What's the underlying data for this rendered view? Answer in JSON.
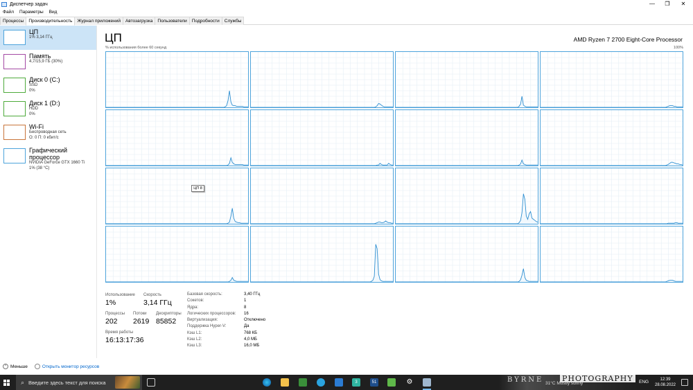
{
  "window": {
    "title": "Диспетчер задач",
    "minimize": "—",
    "maximize": "❐",
    "close": "✕"
  },
  "menu": [
    "Файл",
    "Параметры",
    "Вид"
  ],
  "tabs": [
    "Процессы",
    "Производительность",
    "Журнал приложений",
    "Автозагрузка",
    "Пользователи",
    "Подробности",
    "Службы"
  ],
  "active_tab": 1,
  "sidebar": [
    {
      "name": "ЦП",
      "sub1": "1% 3,14 ГГц",
      "sub2": "",
      "sub3": "",
      "color": "#4da3db"
    },
    {
      "name": "Память",
      "sub1": "4,7/15,9 ГБ (30%)",
      "sub2": "",
      "sub3": "",
      "color": "#a349a4"
    },
    {
      "name": "Диск 0 (C:)",
      "sub1": "SSD",
      "sub2": "0%",
      "sub3": "",
      "color": "#4daa3a"
    },
    {
      "name": "Диск 1 (D:)",
      "sub1": "HDD",
      "sub2": "0%",
      "sub3": "",
      "color": "#4daa3a"
    },
    {
      "name": "Wi-Fi",
      "sub1": "Беспроводная сеть",
      "sub2": "О: 0 П: 0 кбит/с",
      "sub3": "",
      "color": "#c8743a"
    },
    {
      "name": "Графический процессор",
      "sub1": "NVIDIA GeForce GTX 1660 Ti",
      "sub2": "1% (38 °C)",
      "sub3": "",
      "color": "#4da3db"
    }
  ],
  "main": {
    "title": "ЦП",
    "cpu_model": "AMD Ryzen 7 2700 Eight-Core Processor",
    "util_label": "% использования более 60 секунд",
    "pct_max": "100%",
    "tooltip": "ЦП 8"
  },
  "core_graphs": [
    [
      0,
      0,
      0,
      0,
      0,
      0,
      0,
      0,
      0,
      0,
      0,
      0,
      0,
      0,
      0,
      0,
      0,
      0,
      0,
      0,
      0,
      0,
      0,
      0,
      0,
      0,
      0,
      0,
      0,
      0,
      0,
      0,
      0,
      0,
      0,
      0,
      0,
      0,
      0,
      0,
      0,
      0,
      0,
      0,
      0,
      0,
      0,
      0,
      0,
      0,
      0,
      0,
      0,
      0,
      0,
      0,
      0,
      0,
      0,
      0,
      0,
      0,
      0,
      0,
      0,
      0,
      0,
      0,
      0,
      0,
      0,
      0,
      0,
      0,
      0,
      0,
      0,
      0,
      0,
      0,
      0,
      0,
      0,
      1,
      3,
      12,
      30,
      10,
      4,
      3,
      3,
      2,
      2,
      2,
      2,
      2,
      1,
      1,
      1,
      1
    ],
    [
      0,
      0,
      0,
      0,
      0,
      0,
      0,
      0,
      0,
      0,
      0,
      0,
      0,
      0,
      0,
      0,
      0,
      0,
      0,
      0,
      0,
      0,
      0,
      0,
      0,
      0,
      0,
      0,
      0,
      0,
      0,
      0,
      0,
      0,
      0,
      0,
      0,
      0,
      0,
      0,
      0,
      0,
      0,
      0,
      0,
      0,
      0,
      0,
      0,
      0,
      0,
      0,
      0,
      0,
      0,
      0,
      0,
      0,
      0,
      0,
      0,
      0,
      0,
      0,
      0,
      0,
      0,
      0,
      0,
      0,
      0,
      0,
      0,
      0,
      0,
      0,
      0,
      0,
      0,
      0,
      0,
      0,
      0,
      0,
      0,
      0,
      0,
      1,
      3,
      7,
      6,
      4,
      2,
      1,
      1,
      1,
      1,
      1,
      1,
      1
    ],
    [
      0,
      0,
      0,
      0,
      0,
      0,
      0,
      0,
      0,
      0,
      0,
      0,
      0,
      0,
      0,
      0,
      0,
      0,
      0,
      0,
      0,
      0,
      0,
      0,
      0,
      0,
      0,
      0,
      0,
      0,
      0,
      0,
      0,
      0,
      0,
      0,
      0,
      0,
      0,
      0,
      0,
      0,
      0,
      0,
      0,
      0,
      0,
      0,
      0,
      0,
      0,
      0,
      0,
      0,
      0,
      0,
      0,
      0,
      0,
      0,
      0,
      0,
      0,
      0,
      0,
      0,
      0,
      0,
      0,
      0,
      0,
      0,
      0,
      0,
      0,
      0,
      0,
      0,
      0,
      0,
      0,
      0,
      0,
      0,
      0,
      0,
      2,
      6,
      20,
      4,
      2,
      1,
      1,
      1,
      1,
      1,
      1,
      1,
      1,
      1
    ],
    [
      0,
      0,
      0,
      0,
      0,
      0,
      0,
      0,
      0,
      0,
      0,
      0,
      0,
      0,
      0,
      0,
      0,
      0,
      0,
      0,
      0,
      0,
      0,
      0,
      0,
      0,
      0,
      0,
      0,
      0,
      0,
      0,
      0,
      0,
      0,
      0,
      0,
      0,
      0,
      0,
      0,
      0,
      0,
      0,
      0,
      0,
      0,
      0,
      0,
      0,
      0,
      0,
      0,
      0,
      0,
      0,
      0,
      0,
      0,
      0,
      0,
      0,
      0,
      0,
      0,
      0,
      0,
      0,
      0,
      0,
      0,
      0,
      0,
      0,
      0,
      0,
      0,
      0,
      0,
      0,
      0,
      0,
      0,
      0,
      0,
      0,
      0,
      0,
      1,
      2,
      3,
      3,
      3,
      2,
      2,
      1,
      1,
      1,
      1,
      1
    ],
    [
      0,
      0,
      0,
      0,
      0,
      0,
      0,
      0,
      0,
      0,
      0,
      0,
      0,
      0,
      0,
      0,
      0,
      0,
      0,
      0,
      0,
      0,
      0,
      0,
      0,
      0,
      0,
      0,
      0,
      0,
      0,
      0,
      0,
      0,
      0,
      0,
      0,
      0,
      0,
      0,
      0,
      0,
      0,
      0,
      0,
      0,
      0,
      0,
      0,
      0,
      0,
      0,
      0,
      0,
      0,
      0,
      0,
      0,
      0,
      0,
      0,
      0,
      0,
      0,
      0,
      0,
      0,
      0,
      0,
      0,
      0,
      0,
      0,
      0,
      0,
      0,
      0,
      0,
      0,
      0,
      0,
      0,
      0,
      0,
      0,
      1,
      4,
      14,
      6,
      3,
      2,
      2,
      2,
      2,
      2,
      2,
      1,
      1,
      1,
      1
    ],
    [
      0,
      0,
      0,
      0,
      0,
      0,
      0,
      0,
      0,
      0,
      0,
      0,
      0,
      0,
      0,
      0,
      0,
      0,
      0,
      0,
      0,
      0,
      0,
      0,
      0,
      0,
      0,
      0,
      0,
      0,
      0,
      0,
      0,
      0,
      0,
      0,
      0,
      0,
      0,
      0,
      0,
      0,
      0,
      0,
      0,
      0,
      0,
      0,
      0,
      0,
      0,
      0,
      0,
      0,
      0,
      0,
      0,
      0,
      0,
      0,
      0,
      0,
      0,
      0,
      0,
      0,
      0,
      0,
      0,
      0,
      0,
      0,
      0,
      0,
      0,
      0,
      0,
      0,
      0,
      0,
      0,
      0,
      0,
      0,
      0,
      0,
      0,
      0,
      1,
      1,
      4,
      2,
      1,
      1,
      1,
      1,
      4,
      2,
      1,
      1
    ],
    [
      0,
      0,
      0,
      0,
      0,
      0,
      0,
      0,
      0,
      0,
      0,
      0,
      0,
      0,
      0,
      0,
      0,
      0,
      0,
      0,
      0,
      0,
      0,
      0,
      0,
      0,
      0,
      0,
      0,
      0,
      0,
      0,
      0,
      0,
      0,
      0,
      0,
      0,
      0,
      0,
      0,
      0,
      0,
      0,
      0,
      0,
      0,
      0,
      0,
      0,
      0,
      0,
      0,
      0,
      0,
      0,
      0,
      0,
      0,
      0,
      0,
      0,
      0,
      0,
      0,
      0,
      0,
      0,
      0,
      0,
      0,
      0,
      0,
      0,
      0,
      0,
      0,
      0,
      0,
      0,
      0,
      0,
      0,
      0,
      0,
      0,
      1,
      3,
      10,
      3,
      2,
      1,
      1,
      1,
      1,
      1,
      1,
      1,
      1,
      1
    ],
    [
      0,
      0,
      0,
      0,
      0,
      0,
      0,
      0,
      0,
      0,
      0,
      0,
      0,
      0,
      0,
      0,
      0,
      0,
      0,
      0,
      0,
      0,
      0,
      0,
      0,
      0,
      0,
      0,
      0,
      0,
      0,
      0,
      0,
      0,
      0,
      0,
      0,
      0,
      0,
      0,
      0,
      0,
      0,
      0,
      0,
      0,
      0,
      0,
      0,
      0,
      0,
      0,
      0,
      0,
      0,
      0,
      0,
      0,
      0,
      0,
      0,
      0,
      0,
      0,
      0,
      0,
      0,
      0,
      0,
      0,
      0,
      0,
      0,
      0,
      0,
      0,
      0,
      0,
      0,
      0,
      0,
      0,
      0,
      0,
      0,
      0,
      0,
      0,
      1,
      2,
      4,
      6,
      6,
      5,
      4,
      3,
      3,
      2,
      2,
      1
    ],
    [
      0,
      0,
      0,
      0,
      0,
      0,
      0,
      0,
      0,
      0,
      0,
      0,
      0,
      0,
      0,
      0,
      0,
      0,
      0,
      0,
      0,
      0,
      0,
      0,
      0,
      0,
      0,
      0,
      0,
      0,
      0,
      0,
      0,
      0,
      0,
      0,
      0,
      0,
      0,
      0,
      0,
      0,
      0,
      0,
      0,
      0,
      0,
      0,
      0,
      0,
      0,
      0,
      0,
      0,
      0,
      0,
      0,
      0,
      0,
      0,
      0,
      0,
      0,
      0,
      0,
      0,
      0,
      0,
      0,
      0,
      0,
      0,
      0,
      0,
      0,
      0,
      0,
      0,
      0,
      0,
      0,
      0,
      0,
      0,
      0,
      1,
      3,
      14,
      28,
      10,
      4,
      3,
      2,
      2,
      1,
      1,
      1,
      1,
      1,
      1
    ],
    [
      0,
      0,
      0,
      0,
      0,
      0,
      0,
      0,
      0,
      0,
      0,
      0,
      0,
      0,
      0,
      0,
      0,
      0,
      0,
      0,
      0,
      0,
      0,
      0,
      0,
      0,
      0,
      0,
      0,
      0,
      0,
      0,
      0,
      0,
      0,
      0,
      0,
      0,
      0,
      0,
      0,
      0,
      0,
      0,
      0,
      0,
      0,
      0,
      0,
      0,
      0,
      0,
      0,
      0,
      0,
      0,
      0,
      0,
      0,
      0,
      0,
      0,
      0,
      0,
      0,
      0,
      0,
      0,
      0,
      0,
      0,
      0,
      0,
      0,
      0,
      0,
      0,
      0,
      0,
      0,
      0,
      0,
      0,
      0,
      0,
      0,
      0,
      1,
      2,
      3,
      3,
      2,
      2,
      3,
      5,
      3,
      2,
      2,
      1,
      1
    ],
    [
      0,
      0,
      0,
      0,
      0,
      0,
      0,
      0,
      0,
      0,
      0,
      0,
      0,
      0,
      0,
      0,
      0,
      0,
      0,
      0,
      0,
      0,
      0,
      0,
      0,
      0,
      0,
      0,
      0,
      0,
      0,
      0,
      0,
      0,
      0,
      0,
      0,
      0,
      0,
      0,
      0,
      0,
      0,
      0,
      0,
      0,
      0,
      0,
      0,
      0,
      0,
      0,
      0,
      0,
      0,
      0,
      0,
      0,
      0,
      0,
      0,
      0,
      0,
      0,
      0,
      0,
      0,
      0,
      0,
      0,
      0,
      0,
      0,
      0,
      0,
      0,
      0,
      0,
      0,
      0,
      0,
      0,
      0,
      0,
      0,
      0,
      2,
      6,
      20,
      54,
      44,
      14,
      8,
      18,
      22,
      10,
      8,
      6,
      4,
      3
    ],
    [
      0,
      0,
      0,
      0,
      0,
      0,
      0,
      0,
      0,
      0,
      0,
      0,
      0,
      0,
      0,
      0,
      0,
      0,
      0,
      0,
      0,
      0,
      0,
      0,
      0,
      0,
      0,
      0,
      0,
      0,
      0,
      0,
      0,
      0,
      0,
      0,
      0,
      0,
      0,
      0,
      0,
      0,
      0,
      0,
      0,
      0,
      0,
      0,
      0,
      0,
      0,
      0,
      0,
      0,
      0,
      0,
      0,
      0,
      0,
      0,
      0,
      0,
      0,
      0,
      0,
      0,
      0,
      0,
      0,
      0,
      0,
      0,
      0,
      0,
      0,
      0,
      0,
      0,
      0,
      0,
      0,
      0,
      0,
      0,
      0,
      0,
      0,
      0,
      0,
      1,
      1,
      1,
      1,
      1,
      2,
      2,
      1,
      1,
      1,
      1
    ],
    [
      0,
      0,
      0,
      0,
      0,
      0,
      0,
      0,
      0,
      0,
      0,
      0,
      0,
      0,
      0,
      0,
      0,
      0,
      0,
      0,
      0,
      0,
      0,
      0,
      0,
      0,
      0,
      0,
      0,
      0,
      0,
      0,
      0,
      0,
      0,
      0,
      0,
      0,
      0,
      0,
      0,
      0,
      0,
      0,
      0,
      0,
      0,
      0,
      0,
      0,
      0,
      0,
      0,
      0,
      0,
      0,
      0,
      0,
      0,
      0,
      0,
      0,
      0,
      0,
      0,
      0,
      0,
      0,
      0,
      0,
      0,
      0,
      0,
      0,
      0,
      0,
      0,
      0,
      0,
      0,
      0,
      0,
      0,
      0,
      0,
      0,
      1,
      3,
      8,
      3,
      2,
      1,
      1,
      1,
      1,
      1,
      1,
      1,
      1,
      1
    ],
    [
      0,
      0,
      0,
      0,
      0,
      0,
      0,
      0,
      0,
      0,
      0,
      0,
      0,
      0,
      0,
      0,
      0,
      0,
      0,
      0,
      0,
      0,
      0,
      0,
      0,
      0,
      0,
      0,
      0,
      0,
      0,
      0,
      0,
      0,
      0,
      0,
      0,
      0,
      0,
      0,
      0,
      0,
      0,
      0,
      0,
      0,
      0,
      0,
      0,
      0,
      0,
      0,
      0,
      0,
      0,
      0,
      0,
      0,
      0,
      0,
      0,
      0,
      0,
      0,
      0,
      0,
      0,
      0,
      0,
      0,
      0,
      0,
      0,
      0,
      0,
      0,
      0,
      0,
      0,
      0,
      0,
      0,
      0,
      0,
      1,
      3,
      10,
      68,
      60,
      14,
      4,
      2,
      1,
      1,
      1,
      1,
      1,
      1,
      1,
      1
    ],
    [
      0,
      0,
      0,
      0,
      0,
      0,
      0,
      0,
      0,
      0,
      0,
      0,
      0,
      0,
      0,
      0,
      0,
      0,
      0,
      0,
      0,
      0,
      0,
      0,
      0,
      0,
      0,
      0,
      0,
      0,
      0,
      0,
      0,
      0,
      0,
      0,
      0,
      0,
      0,
      0,
      0,
      0,
      0,
      0,
      0,
      0,
      0,
      0,
      0,
      0,
      0,
      0,
      0,
      0,
      0,
      0,
      0,
      0,
      0,
      0,
      0,
      0,
      0,
      0,
      0,
      0,
      0,
      0,
      0,
      0,
      0,
      0,
      0,
      0,
      0,
      0,
      0,
      0,
      0,
      0,
      0,
      0,
      0,
      0,
      0,
      0,
      1,
      4,
      12,
      24,
      8,
      3,
      2,
      1,
      1,
      1,
      1,
      1,
      1,
      1
    ],
    [
      0,
      0,
      0,
      0,
      0,
      0,
      0,
      0,
      0,
      0,
      0,
      0,
      0,
      0,
      0,
      0,
      0,
      0,
      0,
      0,
      0,
      0,
      0,
      0,
      0,
      0,
      0,
      0,
      0,
      0,
      0,
      0,
      0,
      0,
      0,
      0,
      0,
      0,
      0,
      0,
      0,
      0,
      0,
      0,
      0,
      0,
      0,
      0,
      0,
      0,
      0,
      0,
      0,
      0,
      0,
      0,
      0,
      0,
      0,
      0,
      0,
      0,
      0,
      0,
      0,
      0,
      0,
      0,
      0,
      0,
      0,
      0,
      0,
      0,
      0,
      0,
      0,
      0,
      0,
      0,
      0,
      0,
      0,
      0,
      0,
      0,
      0,
      0,
      1,
      2,
      3,
      3,
      3,
      2,
      1,
      1,
      1,
      1,
      1,
      1
    ]
  ],
  "stats": {
    "usage_label": "Использование",
    "usage": "1%",
    "speed_label": "Скорость",
    "speed": "3,14 ГГц",
    "processes_label": "Процессы",
    "processes": "202",
    "threads_label": "Потоки",
    "threads": "2619",
    "handles_label": "Дескрипторы",
    "handles": "85852",
    "uptime_label": "Время работы",
    "uptime": "16:13:17:36"
  },
  "details": [
    {
      "k": "Базовая скорость:",
      "v": "3,40 ГГц"
    },
    {
      "k": "Сокетов:",
      "v": "1"
    },
    {
      "k": "Ядра:",
      "v": "8"
    },
    {
      "k": "Логических процессоров:",
      "v": "16"
    },
    {
      "k": "Виртуализация:",
      "v": "Отключено"
    },
    {
      "k": "Поддержка Hyper-V:",
      "v": "Да"
    },
    {
      "k": "Кэш L1:",
      "v": "768 КБ"
    },
    {
      "k": "Кэш L2:",
      "v": "4,0 МБ"
    },
    {
      "k": "Кэш L3:",
      "v": "16,0 МБ"
    }
  ],
  "footer": {
    "less": "Меньше",
    "monitor": "Открыть монитор ресурсов"
  },
  "taskbar": {
    "search_placeholder": "Введите здесь текст для поиска",
    "badge": "51",
    "brand_left": "BYRNE",
    "brand_right": "PHOTOGRAPHY",
    "weather": "31°C Mostly sunny",
    "lang": "ENG",
    "time": "12:39",
    "date": "28.08.2022"
  },
  "colors": {
    "accent": "#4da3db",
    "selected": "#cce4f7",
    "link": "#0066cc",
    "taskbar": "#1f1f1f"
  }
}
